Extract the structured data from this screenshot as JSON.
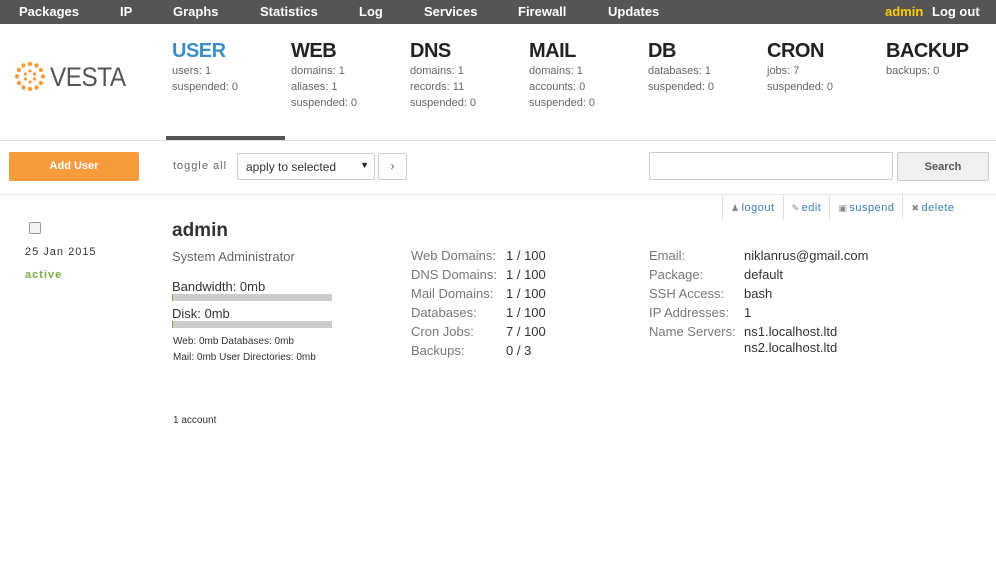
{
  "nav": {
    "items": [
      "Packages",
      "IP",
      "Graphs",
      "Statistics",
      "Log",
      "Services",
      "Firewall",
      "Updates"
    ],
    "user": "admin",
    "logout": "Log out"
  },
  "logo": {
    "text": "VESTA",
    "color": "#f79b3d"
  },
  "tabs": [
    {
      "title": "USER",
      "active": true,
      "stats": [
        "users: 1",
        "suspended: 0"
      ]
    },
    {
      "title": "WEB",
      "stats": [
        "domains: 1",
        "aliases: 1",
        "suspended: 0"
      ]
    },
    {
      "title": "DNS",
      "stats": [
        "domains: 1",
        "records: 11",
        "suspended: 0"
      ]
    },
    {
      "title": "MAIL",
      "stats": [
        "domains: 1",
        "accounts: 0",
        "suspended: 0"
      ]
    },
    {
      "title": "DB",
      "stats": [
        "databases: 1",
        "suspended: 0"
      ]
    },
    {
      "title": "CRON",
      "stats": [
        "jobs: 7",
        "suspended: 0"
      ]
    },
    {
      "title": "BACKUP",
      "stats": [
        "backups: 0"
      ]
    }
  ],
  "toolbar": {
    "add_user": "Add User",
    "toggle_all": "toggle all",
    "bulk_action": "apply to selected",
    "go": "›",
    "search_value": "",
    "search_button": "Search"
  },
  "row": {
    "actions": [
      {
        "icon": "user-icon",
        "glyph": "👤",
        "label": "logout"
      },
      {
        "icon": "pencil-icon",
        "glyph": "✎",
        "label": "edit"
      },
      {
        "icon": "lock-icon",
        "glyph": "🔒",
        "label": "suspend"
      },
      {
        "icon": "close-icon",
        "glyph": "✖",
        "label": "delete"
      }
    ],
    "date": "25 Jan 2015",
    "status": "active",
    "username": "admin",
    "role": "System Administrator",
    "bandwidth_label": "Bandwidth: 0mb",
    "bandwidth_fraction": 0.0,
    "disk_label": "Disk: 0mb",
    "disk_fraction": 0.0,
    "usage_line1": "Web: 0mb  Databases: 0mb",
    "usage_line2": "Mail: 0mb  User Directories: 0mb",
    "limits": [
      {
        "label": "Web Domains:",
        "value": "1 / 100"
      },
      {
        "label": "DNS Domains:",
        "value": "1 / 100"
      },
      {
        "label": "Mail Domains:",
        "value": "1 / 100"
      },
      {
        "label": "Databases:",
        "value": "1 / 100"
      },
      {
        "label": "Cron Jobs:",
        "value": "7 / 100"
      },
      {
        "label": "Backups:",
        "value": "0 / 3"
      }
    ],
    "details": [
      {
        "label": "Email:",
        "value": "niklanrus@gmail.com"
      },
      {
        "label": "Package:",
        "value": "default"
      },
      {
        "label": "SSH Access:",
        "value": "bash"
      },
      {
        "label": "IP Addresses:",
        "value": "1"
      },
      {
        "label": "Name Servers:",
        "value": "ns1.localhost.ltd"
      },
      {
        "label": "",
        "value": "ns2.localhost.ltd"
      }
    ]
  },
  "footer": {
    "count": "1 account"
  }
}
